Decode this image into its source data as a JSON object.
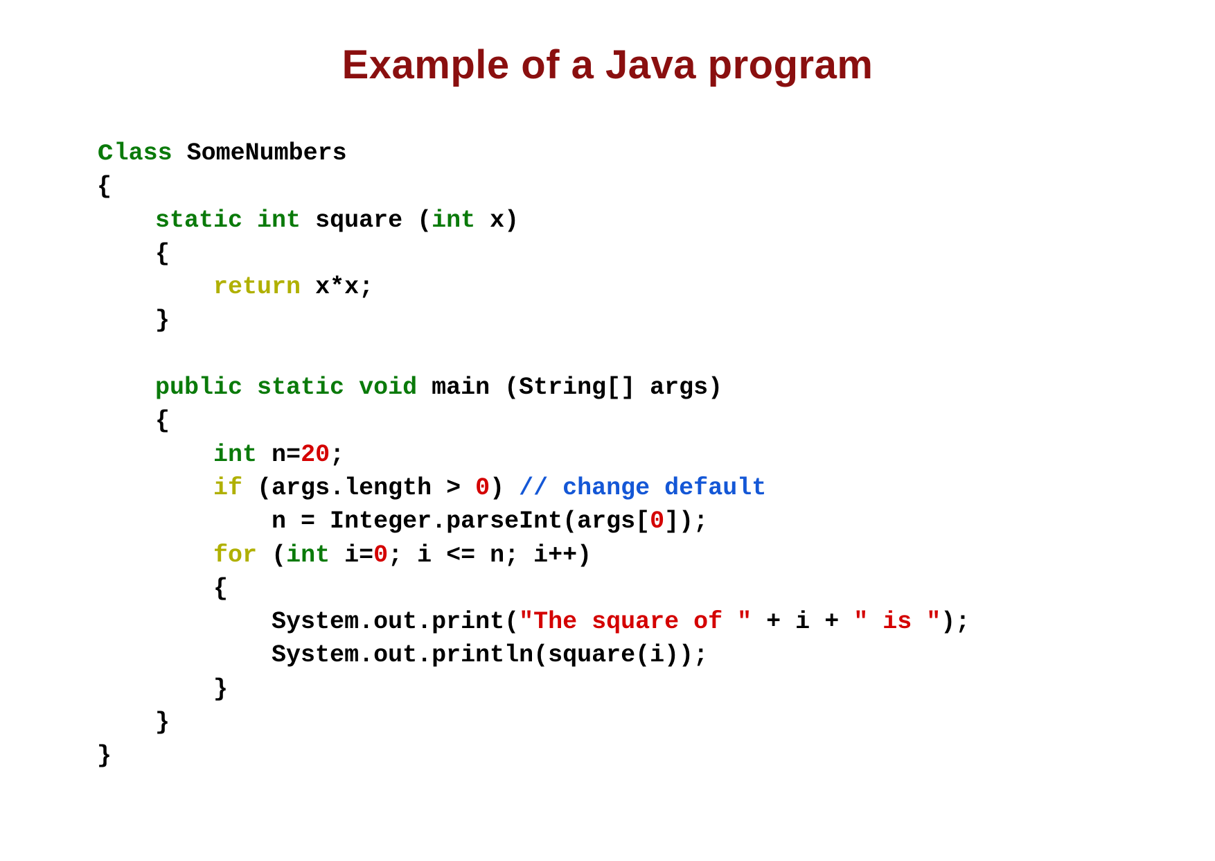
{
  "title": "Example of a Java program",
  "code": {
    "l1_kw": "c",
    "l1_kw2": "lass",
    "l1_name": " SomeNumbers",
    "l2": "{",
    "l3_kw": "static int",
    "l3_rest": " square (",
    "l3_kw2": "int",
    "l3_rest2": " x)",
    "l4": "{",
    "l5_kw": "return",
    "l5_rest": " x*x;",
    "l6": "}",
    "l7_kw": "public static void",
    "l7_rest": " main (String[] args)",
    "l8": "{",
    "l9_kw": "int",
    "l9_mid": " n=",
    "l9_num": "20",
    "l9_end": ";",
    "l10_kw": "if",
    "l10_a": " (args.length > ",
    "l10_num": "0",
    "l10_b": ")",
    "l10_cmt": " // change default",
    "l11_a": "n = Integer.parseInt(args[",
    "l11_num": "0",
    "l11_b": "]);",
    "l12_kw": "for",
    "l12_a": " (",
    "l12_kw2": "int",
    "l12_b": " i=",
    "l12_num": "0",
    "l12_c": "; i <= n; i++)",
    "l13": "{",
    "l14_a": "System.out.print(",
    "l14_s1": "\"The square of \"",
    "l14_b": " + i + ",
    "l14_s2": "\" is \"",
    "l14_c": ");",
    "l15": "System.out.println(square(i));",
    "l16": "}",
    "l17": "}",
    "l18": "}"
  }
}
